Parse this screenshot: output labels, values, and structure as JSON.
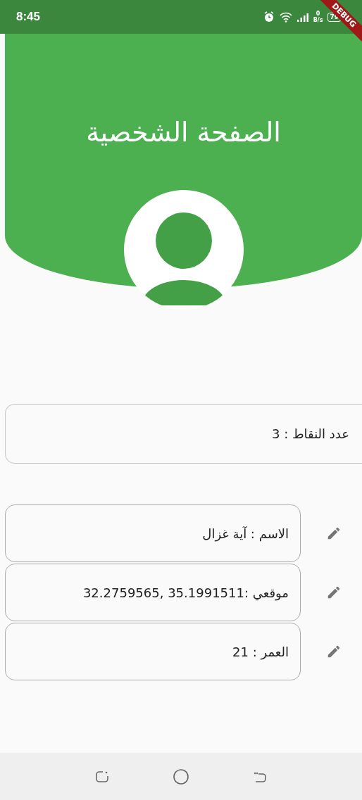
{
  "status_bar": {
    "time": "8:45",
    "net_speed_value": "0",
    "net_speed_unit": "B/s",
    "battery": "79"
  },
  "debug_banner": {
    "label": "DEBUG"
  },
  "header": {
    "title": "الصفحة الشخصية"
  },
  "points_card": {
    "text": "عدد النقاط : 3"
  },
  "fields": [
    {
      "text": "الاسم : آية غزال"
    },
    {
      "text": "موقعي :35.1991511  ,32.2759565"
    },
    {
      "text": "العمر : 21"
    }
  ]
}
